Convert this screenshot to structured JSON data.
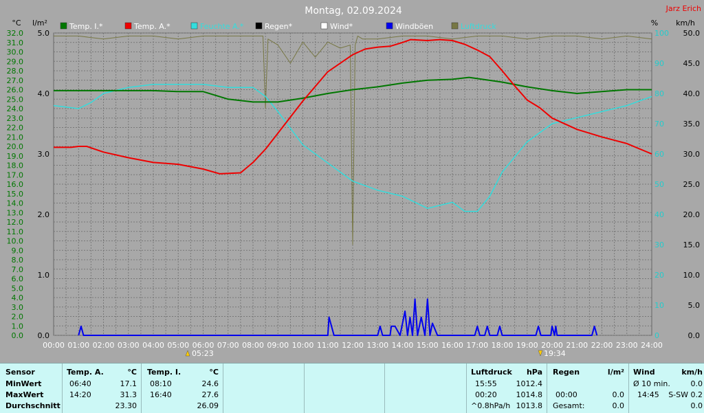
{
  "title": "Montag, 02.09.2024",
  "author": "Jarz Erich",
  "colors": {
    "background": "#a8a8a8",
    "grid": "#777777",
    "temp_i": "#007700",
    "temp_a": "#ee0000",
    "feuchte": "#33dddd",
    "regen": "#000000",
    "wind": "#ffffff",
    "windboeen": "#0000ee",
    "luftdruck": "#777744",
    "left_axis": "#007700",
    "right_axis": "#2cc"
  },
  "axis_units": {
    "temp": "°C",
    "rain": "l/m²",
    "humidity": "%",
    "wind": "km/h"
  },
  "legend": [
    {
      "label": "Temp. I.*",
      "color": "#007700",
      "text_color": "#ffffff"
    },
    {
      "label": "Temp. A.*",
      "color": "#ee0000",
      "text_color": "#ffffff"
    },
    {
      "label": "Feuchte A.*",
      "color": "#33dddd",
      "text_color": "#33dddd"
    },
    {
      "label": "Regen*",
      "color": "#000000",
      "text_color": "#ffffff"
    },
    {
      "label": "Wind*",
      "color": "#ffffff",
      "text_color": "#ffffff"
    },
    {
      "label": "Windböen",
      "color": "#0000ee",
      "text_color": "#ffffff"
    },
    {
      "label": "Luftdruck",
      "color": "#777744",
      "text_color": "#33dddd"
    }
  ],
  "sunrise": "05:23",
  "sunset": "19:34",
  "chart_data": {
    "type": "line",
    "title": "Montag, 02.09.2024",
    "xlim": [
      0,
      24
    ],
    "x_ticks": [
      "00:00",
      "01:00",
      "02:00",
      "03:00",
      "04:00",
      "05:00",
      "06:00",
      "07:00",
      "08:00",
      "09:00",
      "10:00",
      "11:00",
      "12:00",
      "13:00",
      "14:00",
      "15:00",
      "16:00",
      "17:00",
      "18:00",
      "19:00",
      "20:00",
      "21:00",
      "22:00",
      "23:00",
      "24:00"
    ],
    "y_temp": {
      "range": [
        0,
        32
      ],
      "ticks": [
        "0.0",
        "1.0",
        "2.0",
        "3.0",
        "4.0",
        "5.0",
        "6.0",
        "7.0",
        "8.0",
        "9.0",
        "10.0",
        "11.0",
        "12.0",
        "13.0",
        "14.0",
        "15.0",
        "16.0",
        "17.0",
        "18.0",
        "19.0",
        "20.0",
        "21.0",
        "22.0",
        "23.0",
        "24.0",
        "25.0",
        "26.0",
        "27.0",
        "28.0",
        "29.0",
        "30.0",
        "31.0",
        "32.0"
      ]
    },
    "y_rain": {
      "range": [
        0,
        5
      ],
      "ticks": [
        "0.0",
        "1.0",
        "2.0",
        "3.0",
        "4.0",
        "5.0"
      ]
    },
    "y_humidity": {
      "range": [
        0,
        100
      ],
      "ticks": [
        "0",
        "10",
        "20",
        "30",
        "40",
        "50",
        "60",
        "70",
        "80",
        "90",
        "100"
      ]
    },
    "y_wind": {
      "range": [
        0,
        50
      ],
      "ticks": [
        "0.0",
        "5.0",
        "10.0",
        "15.0",
        "20.0",
        "25.0",
        "30.0",
        "35.0",
        "40.0",
        "45.0",
        "50.0"
      ]
    },
    "series": [
      {
        "name": "Temp. I.*",
        "axis": "temp",
        "x": [
          0,
          4,
          5,
          6,
          7,
          8,
          9,
          10,
          11,
          12,
          13,
          14,
          15,
          16,
          16.67,
          18,
          19,
          20,
          21,
          22,
          23,
          24
        ],
        "values": [
          25.9,
          25.9,
          25.8,
          25.8,
          25.0,
          24.7,
          24.7,
          25.1,
          25.6,
          26.0,
          26.3,
          26.7,
          27.0,
          27.1,
          27.3,
          26.8,
          26.3,
          25.9,
          25.6,
          25.8,
          26.0,
          26.0
        ]
      },
      {
        "name": "Temp. A.*",
        "axis": "temp",
        "x": [
          0,
          0.7,
          1,
          1.33,
          2,
          3,
          4,
          5,
          6,
          6.67,
          7.5,
          8,
          8.5,
          9,
          10,
          11,
          12,
          12.5,
          13,
          13.5,
          14,
          14.33,
          15,
          15.5,
          16,
          16.5,
          17,
          17.5,
          18,
          18.5,
          19,
          19.5,
          20,
          21,
          22,
          23,
          24
        ],
        "values": [
          19.9,
          19.9,
          20.0,
          20.0,
          19.4,
          18.8,
          18.3,
          18.1,
          17.6,
          17.1,
          17.2,
          18.3,
          19.7,
          21.4,
          24.8,
          27.9,
          29.7,
          30.3,
          30.5,
          30.6,
          31.0,
          31.3,
          31.2,
          31.3,
          31.2,
          30.8,
          30.2,
          29.5,
          28.0,
          26.4,
          24.9,
          24.1,
          23.0,
          21.8,
          21.0,
          20.3,
          19.2
        ]
      },
      {
        "name": "Feuchte A.*",
        "axis": "humidity",
        "x": [
          0,
          1,
          1.5,
          2,
          3,
          4,
          5,
          6,
          7,
          8,
          8.5,
          9,
          10,
          11,
          12,
          13,
          14,
          15,
          15.5,
          16,
          16.5,
          17,
          17.5,
          18,
          19,
          20,
          21,
          22,
          23,
          24
        ],
        "values": [
          76,
          75,
          77,
          80,
          82,
          83,
          83,
          83,
          82,
          82,
          79,
          74,
          63,
          57,
          51,
          48,
          46,
          42,
          43,
          44,
          41,
          41,
          46,
          54,
          64,
          70,
          72,
          74,
          76,
          79
        ]
      },
      {
        "name": "Luftdruck",
        "axis": "humidity",
        "x": [
          0,
          1,
          2,
          3,
          4,
          5,
          6,
          7,
          8,
          8.4,
          8.5,
          8.6,
          9,
          9.5,
          10,
          10.5,
          11,
          11.5,
          11.9,
          12.0,
          12.1,
          12.2,
          12.4,
          13,
          14,
          15,
          16,
          17,
          18,
          19,
          20,
          21,
          22,
          23,
          24
        ],
        "values": [
          99,
          99,
          98,
          99,
          99,
          98,
          99,
          99,
          99,
          99,
          75,
          98,
          96,
          90,
          97,
          92,
          97,
          95,
          96,
          30,
          96,
          99,
          98,
          98,
          99,
          99,
          98,
          99,
          99,
          98,
          99,
          99,
          98,
          99,
          98
        ]
      },
      {
        "name": "Windböen",
        "axis": "wind",
        "x": [
          1,
          1.1,
          1.2,
          11,
          11.05,
          11.25,
          13,
          13.1,
          13.2,
          13.5,
          13.55,
          13.7,
          13.9,
          14.0,
          14.1,
          14.2,
          14.3,
          14.4,
          14.5,
          14.6,
          14.75,
          14.9,
          15.0,
          15.1,
          15.2,
          15.4,
          16.9,
          17.0,
          17.1,
          17.3,
          17.4,
          17.5,
          17.8,
          17.9,
          18.0,
          19.35,
          19.45,
          19.55,
          19.95,
          20.0,
          20.1,
          20.15,
          20.2,
          20.3,
          21.6,
          21.7,
          21.8
        ],
        "values": [
          0,
          1.5,
          0,
          0,
          3,
          0,
          0,
          1.5,
          0,
          0,
          1.5,
          1.5,
          0,
          2,
          4,
          0,
          3,
          0,
          6,
          0,
          3,
          0,
          6,
          0,
          2,
          0,
          0,
          1.5,
          0,
          0,
          1.5,
          0,
          0,
          1.5,
          0,
          0,
          1.5,
          0,
          0,
          1.5,
          0,
          1.5,
          0,
          0,
          0,
          1.5,
          0
        ]
      }
    ]
  },
  "table": {
    "sensor": {
      "header": "Sensor",
      "rows": [
        "MinWert",
        "MaxWert",
        "Durchschnitt"
      ]
    },
    "temp_a": {
      "header": "Temp. A.",
      "unit": "°C",
      "times": [
        "06:40",
        "14:20",
        ""
      ],
      "values": [
        "17.1",
        "31.3",
        "23.30"
      ]
    },
    "temp_i": {
      "header": "Temp. I.",
      "unit": "°C",
      "times": [
        "08:10",
        "16:40",
        ""
      ],
      "values": [
        "24.6",
        "27.6",
        "26.09"
      ]
    },
    "luftdruck": {
      "header": "Luftdruck",
      "unit": "hPa",
      "times": [
        "15:55",
        "00:20",
        "^0.8hPa/h"
      ],
      "values": [
        "1012.4",
        "1014.8",
        "1013.8"
      ]
    },
    "regen": {
      "header": "Regen",
      "unit": "l/m²",
      "times": [
        "",
        "00:00",
        "Gesamt:"
      ],
      "values": [
        "",
        "0.0",
        "0.0"
      ]
    },
    "wind": {
      "header": "Wind",
      "unit": "km/h",
      "times": [
        "Ø 10 min.",
        "14:45",
        ""
      ],
      "values": [
        "0.0",
        "S-SW 0.2",
        "0.0"
      ]
    }
  }
}
